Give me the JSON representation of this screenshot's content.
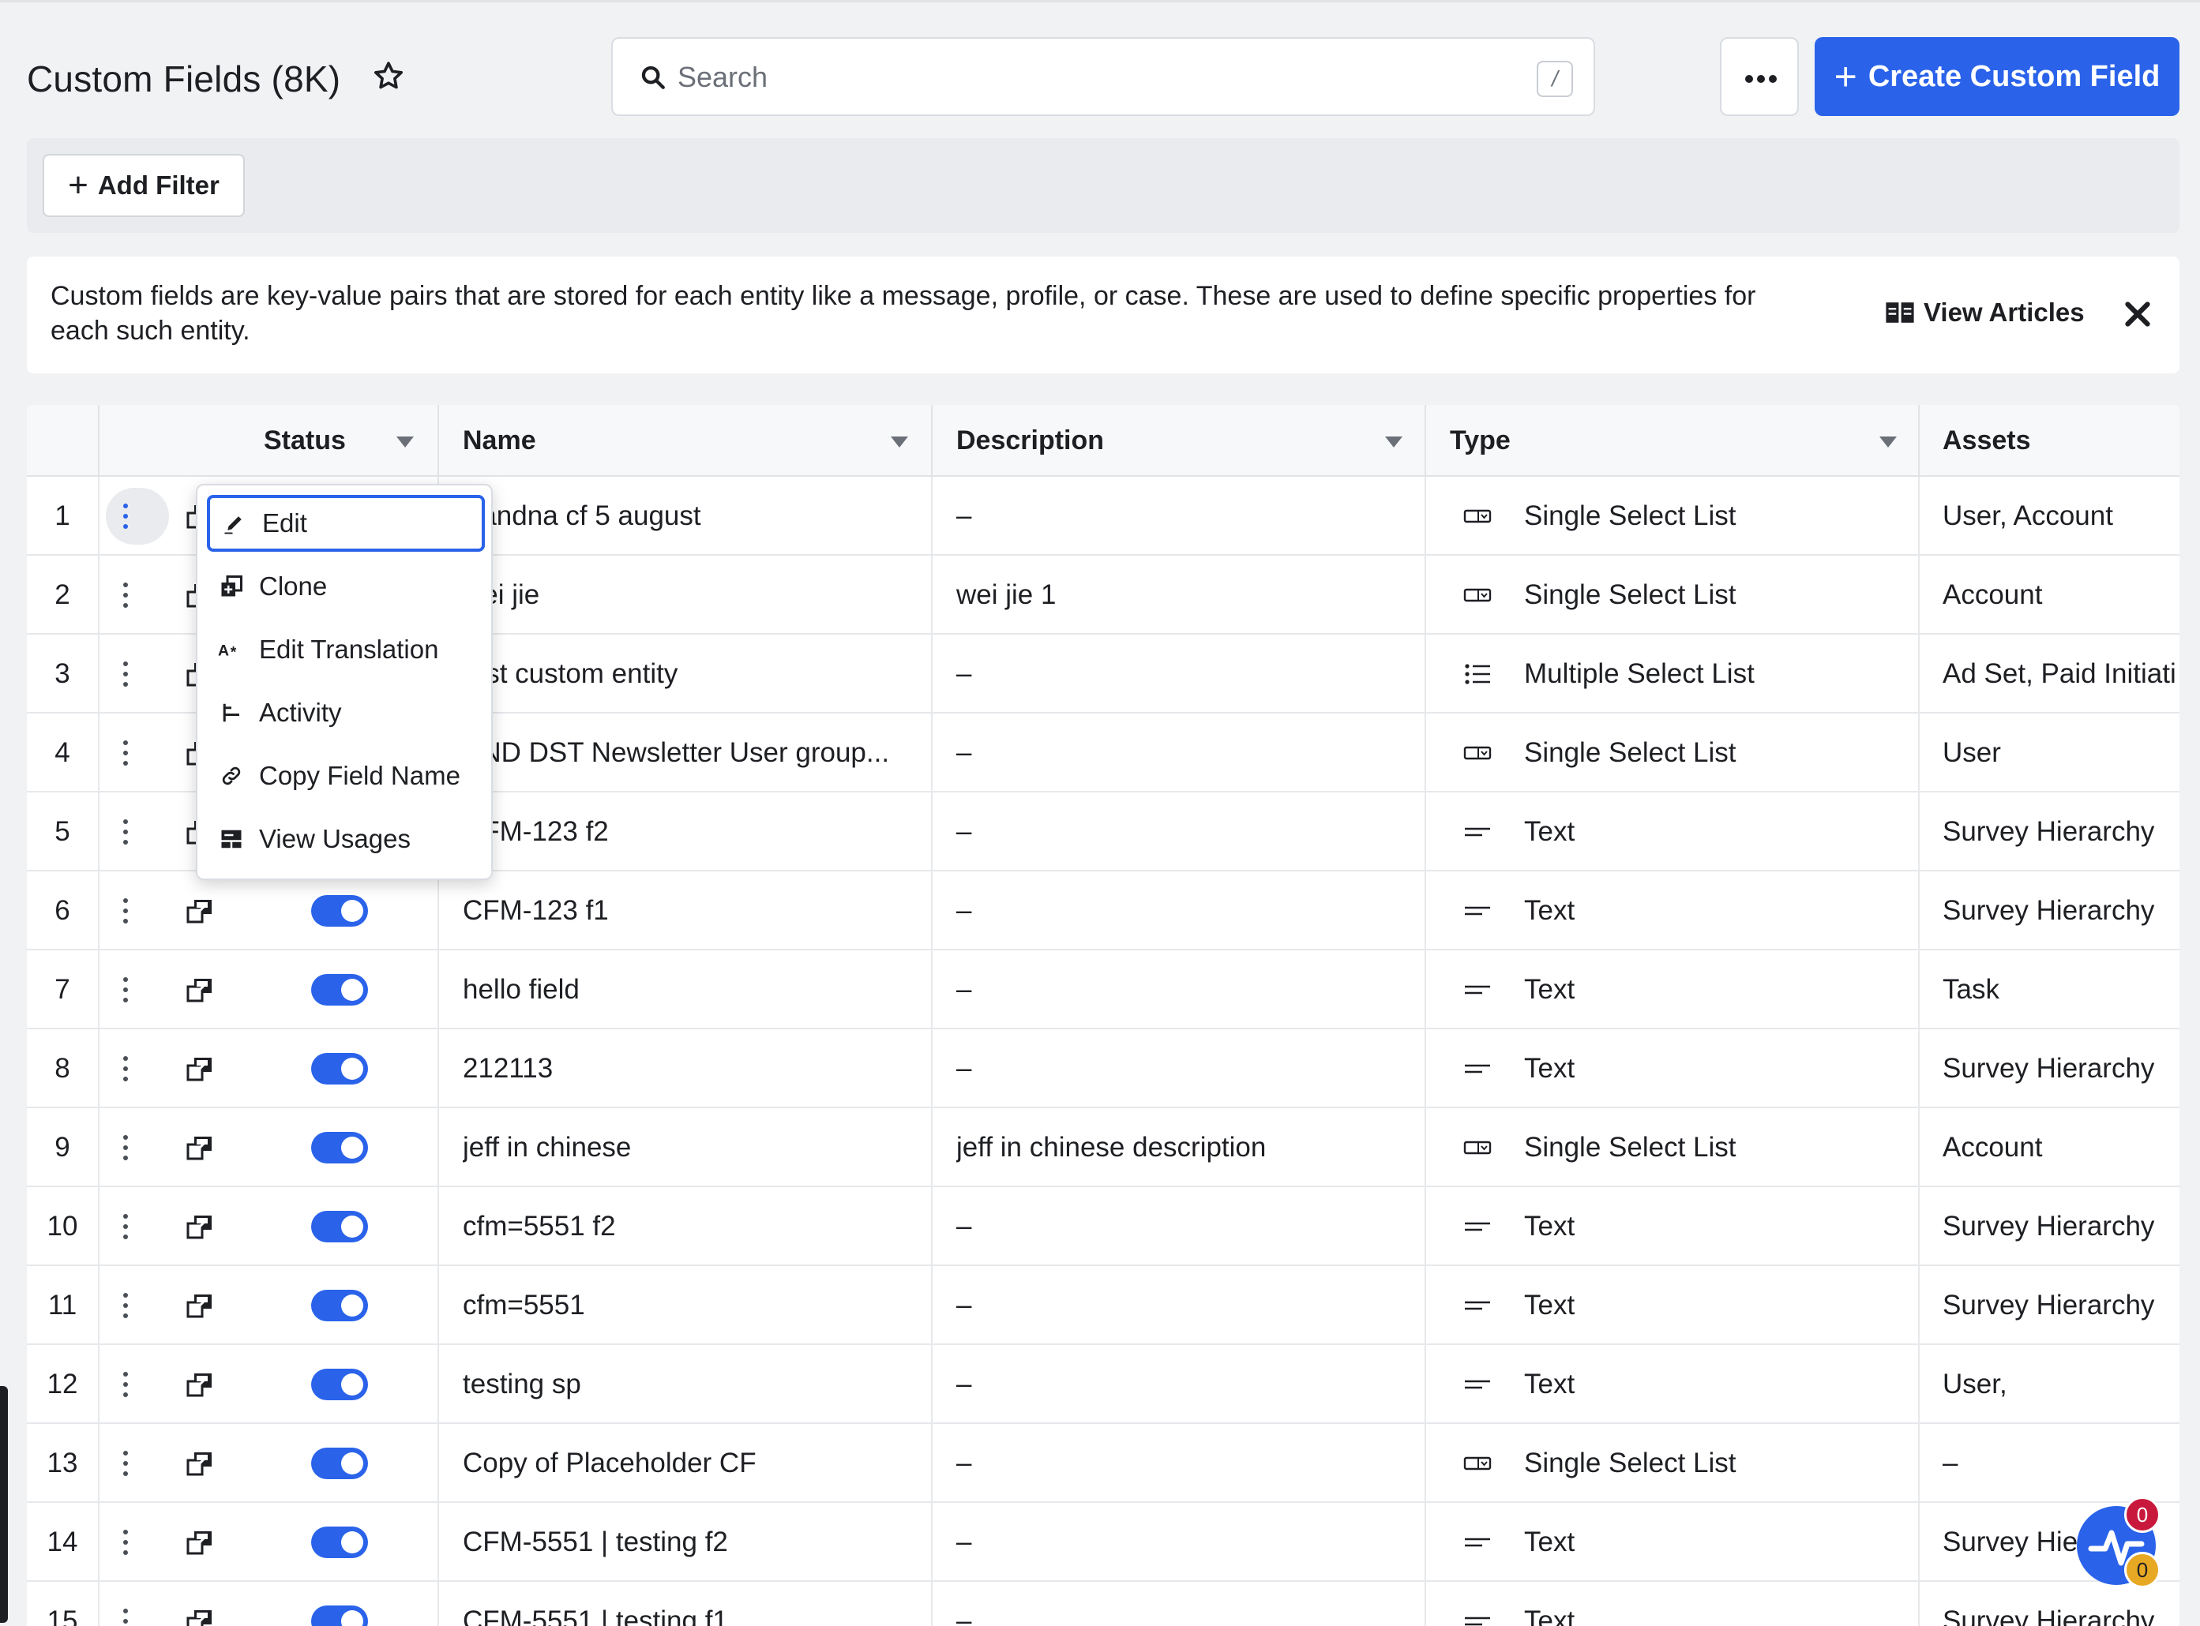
{
  "header": {
    "title": "Custom Fields (8K)",
    "search_placeholder": "Search",
    "search_shortcut": "/",
    "create_label": "Create Custom Field"
  },
  "filters": {
    "add_filter_label": "Add Filter"
  },
  "info": {
    "text": "Custom fields are key-value pairs that are stored for each entity like a message, profile, or case. These are used to define specific properties for each such entity.",
    "view_articles_label": "View Articles"
  },
  "table": {
    "columns": [
      "Status",
      "Name",
      "Description",
      "Type",
      "Assets"
    ],
    "rows": [
      {
        "num": "1",
        "name": "Sandna cf 5 august",
        "description": "–",
        "type": "Single Select List",
        "type_icon": "select-list-icon",
        "assets": "User, Account"
      },
      {
        "num": "2",
        "name": "wei jie",
        "description": "wei jie 1",
        "type": "Single Select List",
        "type_icon": "select-list-icon",
        "assets": "Account"
      },
      {
        "num": "3",
        "name": "test custom entity",
        "description": "–",
        "type": "Multiple Select List",
        "type_icon": "multi-list-icon",
        "assets": "Ad Set, Paid Initiati"
      },
      {
        "num": "4",
        "name": "AND DST Newsletter User group...",
        "description": "–",
        "type": "Single Select List",
        "type_icon": "select-list-icon",
        "assets": "User"
      },
      {
        "num": "5",
        "name": "CFM-123 f2",
        "description": "–",
        "type": "Text",
        "type_icon": "text-icon",
        "assets": "Survey Hierarchy"
      },
      {
        "num": "6",
        "name": "CFM-123 f1",
        "description": "–",
        "type": "Text",
        "type_icon": "text-icon",
        "assets": "Survey Hierarchy"
      },
      {
        "num": "7",
        "name": "hello field",
        "description": "–",
        "type": "Text",
        "type_icon": "text-icon",
        "assets": "Task"
      },
      {
        "num": "8",
        "name": "212113",
        "description": "–",
        "type": "Text",
        "type_icon": "text-icon",
        "assets": "Survey Hierarchy"
      },
      {
        "num": "9",
        "name": "jeff in chinese",
        "description": "jeff in chinese description",
        "type": "Single Select List",
        "type_icon": "select-list-icon",
        "assets": "Account"
      },
      {
        "num": "10",
        "name": "cfm=5551 f2",
        "description": "–",
        "type": "Text",
        "type_icon": "text-icon",
        "assets": "Survey Hierarchy"
      },
      {
        "num": "11",
        "name": "cfm=5551",
        "description": "–",
        "type": "Text",
        "type_icon": "text-icon",
        "assets": "Survey Hierarchy"
      },
      {
        "num": "12",
        "name": "testing sp",
        "description": "–",
        "type": "Text",
        "type_icon": "text-icon",
        "assets": "User,"
      },
      {
        "num": "13",
        "name": "Copy of Placeholder CF",
        "description": "–",
        "type": "Single Select List",
        "type_icon": "select-list-icon",
        "assets": "–"
      },
      {
        "num": "14",
        "name": "CFM-5551 | testing f2",
        "description": "–",
        "type": "Text",
        "type_icon": "text-icon",
        "assets": "Survey Hie"
      },
      {
        "num": "15",
        "name": "CFM-5551 | testing f1",
        "description": "–",
        "type": "Text",
        "type_icon": "text-icon",
        "assets": "Survey Hierarchy"
      }
    ]
  },
  "context_menu": {
    "items": [
      {
        "label": "Edit",
        "icon": "pencil-icon"
      },
      {
        "label": "Clone",
        "icon": "clone-icon"
      },
      {
        "label": "Edit Translation",
        "icon": "translate-icon"
      },
      {
        "label": "Activity",
        "icon": "activity-icon"
      },
      {
        "label": "Copy Field Name",
        "icon": "link-icon"
      },
      {
        "label": "View Usages",
        "icon": "usages-icon"
      }
    ]
  },
  "widget": {
    "badge_red": "0",
    "badge_yellow": "0"
  },
  "colors": {
    "accent": "#2a63ea",
    "badge_red": "#c8193c",
    "badge_yellow": "#e7a823"
  }
}
